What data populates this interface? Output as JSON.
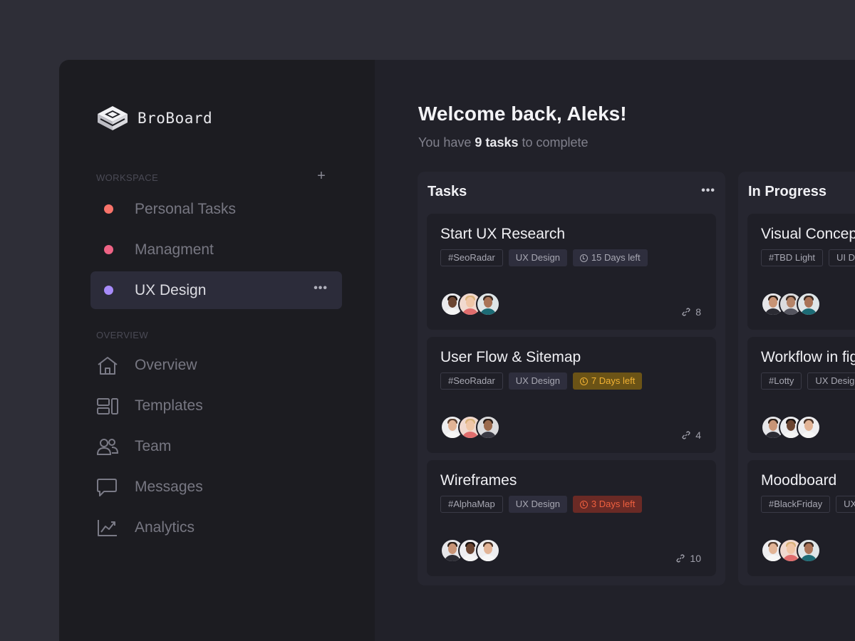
{
  "brand": {
    "name": "BroBoard"
  },
  "sidebar": {
    "workspace_label": "WORKSPACE",
    "add_label": "+",
    "workspaces": [
      {
        "label": "Personal Tasks",
        "color": "#f8736a"
      },
      {
        "label": "Managment",
        "color": "#ee6385"
      },
      {
        "label": "UX Design",
        "color": "#a78bfa",
        "active": true,
        "more": "•••"
      }
    ],
    "overview_label": "OVERVIEW",
    "nav": [
      {
        "label": "Overview",
        "icon": "home-icon"
      },
      {
        "label": "Templates",
        "icon": "templates-icon"
      },
      {
        "label": "Team",
        "icon": "team-icon"
      },
      {
        "label": "Messages",
        "icon": "message-icon"
      },
      {
        "label": "Analytics",
        "icon": "analytics-icon"
      }
    ]
  },
  "header": {
    "welcome": "Welcome back, Aleks!",
    "subtitle_prefix": "You have ",
    "subtitle_count": "9 tasks",
    "subtitle_suffix": " to complete"
  },
  "columns": [
    {
      "title": "Tasks",
      "more": "•••",
      "cards": [
        {
          "title": "Start UX Research",
          "tags": [
            "#SeoRadar",
            "UX Design"
          ],
          "deadline": "15 Days left",
          "deadline_status": "normal",
          "links": "8"
        },
        {
          "title": "User Flow & Sitemap",
          "tags": [
            "#SeoRadar",
            "UX Design"
          ],
          "deadline": "7 Days left",
          "deadline_status": "warning",
          "links": "4"
        },
        {
          "title": "Wireframes",
          "tags": [
            "#AlphaMap",
            "UX Design"
          ],
          "deadline": "3 Days left",
          "deadline_status": "danger",
          "links": "10"
        }
      ]
    },
    {
      "title": "In Progress",
      "cards": [
        {
          "title": "Visual Concept",
          "tags": [
            "#TBD Light",
            "UI Design"
          ]
        },
        {
          "title": "Workflow in figma",
          "tags": [
            "#Lotty",
            "UX Design"
          ]
        },
        {
          "title": "Moodboard",
          "tags": [
            "#BlackFriday",
            "UX Design"
          ]
        }
      ]
    }
  ],
  "colors": {
    "accent": "#a78bfa",
    "warning": "#f2b233",
    "danger": "#f0603f",
    "background": "#212129",
    "sidebar": "#1c1c21"
  }
}
